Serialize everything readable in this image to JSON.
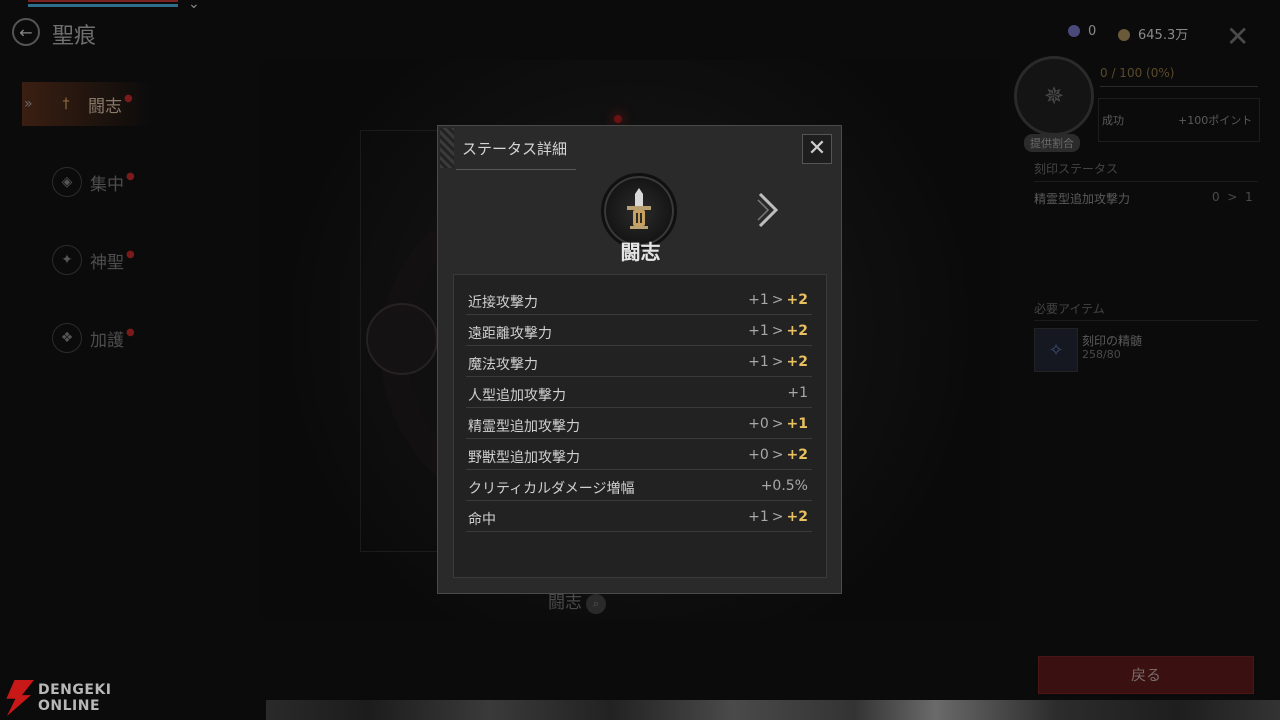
{
  "header": {
    "title": "聖痕"
  },
  "nav": {
    "items": [
      {
        "label": "闘志",
        "icon": "sword-icon",
        "active": true
      },
      {
        "label": "集中",
        "icon": "target-icon",
        "active": false
      },
      {
        "label": "神聖",
        "icon": "holy-icon",
        "active": false
      },
      {
        "label": "加護",
        "icon": "shield-icon",
        "active": false
      }
    ]
  },
  "currency": {
    "gems": "0",
    "gold": "645.3万"
  },
  "right_panel": {
    "progress": "0 / 100 (0%)",
    "badge": "提供割合",
    "success_label": "成功",
    "success_value": "+100ポイント",
    "section_stats": "刻印ステータス",
    "stat_name": "精霊型追加攻撃力",
    "stat_from": "0",
    "stat_to": "1",
    "section_items": "必要アイテム",
    "item_name": "刻印の精髄",
    "item_count": "258/80",
    "back_label": "戻る"
  },
  "bottom": {
    "title": "闘志"
  },
  "watermark": {
    "line1": "DENGEKI",
    "line2": "ONLINE"
  },
  "modal": {
    "title": "ステータス詳細",
    "category": "闘志",
    "stats": [
      {
        "name": "近接攻撃力",
        "from": "+1",
        "to": "+2"
      },
      {
        "name": "遠距離攻撃力",
        "from": "+1",
        "to": "+2"
      },
      {
        "name": "魔法攻撃力",
        "from": "+1",
        "to": "+2"
      },
      {
        "name": "人型追加攻撃力",
        "from": "+1",
        "to": ""
      },
      {
        "name": "精霊型追加攻撃力",
        "from": "+0",
        "to": "+1"
      },
      {
        "name": "野獣型追加攻撃力",
        "from": "+0",
        "to": "+2"
      },
      {
        "name": "クリティカルダメージ増幅",
        "from": "+0.5%",
        "to": ""
      },
      {
        "name": "命中",
        "from": "+1",
        "to": "+2"
      }
    ]
  },
  "colors": {
    "accent_gold": "#e8c060",
    "back_button": "#3a1010",
    "brand_red": "#c81818"
  }
}
